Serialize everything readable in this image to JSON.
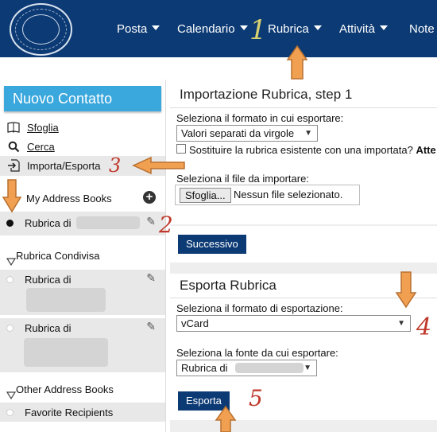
{
  "nav": {
    "items": [
      {
        "label": "Posta"
      },
      {
        "label": "Calendario"
      },
      {
        "label": "Rubrica"
      },
      {
        "label": "Attività"
      },
      {
        "label": "Note"
      }
    ]
  },
  "sidebar": {
    "new_contact_label": "Nuovo Contatto",
    "links": [
      {
        "label": "Sfoglia",
        "icon": "book-icon"
      },
      {
        "label": "Cerca",
        "icon": "search-icon"
      },
      {
        "label": "Importa/Esporta",
        "icon": "import-export-icon"
      }
    ],
    "my_address_books_label": "My Address Books",
    "my_book_label": "Rubrica di",
    "shared_label": "Rubrica Condivisa",
    "shared_books": [
      {
        "label": "Rubrica di"
      },
      {
        "label": "Rubrica di"
      }
    ],
    "other_label": "Other Address Books",
    "favorite_label": "Favorite Recipients"
  },
  "import": {
    "title": "Importazione Rubrica, step 1",
    "format_label": "Seleziona il formato in cui esportare:",
    "format_value": "Valori separati da virgole",
    "replace_label": "Sostituire la rubrica esistente con una importata?",
    "replace_warning": "Atte",
    "file_label": "Seleziona il file da importare:",
    "file_button": "Sfoglia...",
    "file_status": "Nessun file selezionato.",
    "next_button": "Successivo"
  },
  "export": {
    "title": "Esporta Rubrica",
    "format_label": "Seleziona il formato di esportazione:",
    "format_value": "vCard",
    "source_label": "Seleziona la fonte da cui esportare:",
    "source_value": "Rubrica di",
    "export_button": "Esporta"
  },
  "annotations": [
    "1",
    "2",
    "3",
    "4",
    "5"
  ],
  "colors": {
    "header": "#0c3a74",
    "new_contact": "#3aa7dd",
    "button": "#0c3a74",
    "annotation_arrow": "#f0a050",
    "annotation_number": "#c0392b"
  }
}
